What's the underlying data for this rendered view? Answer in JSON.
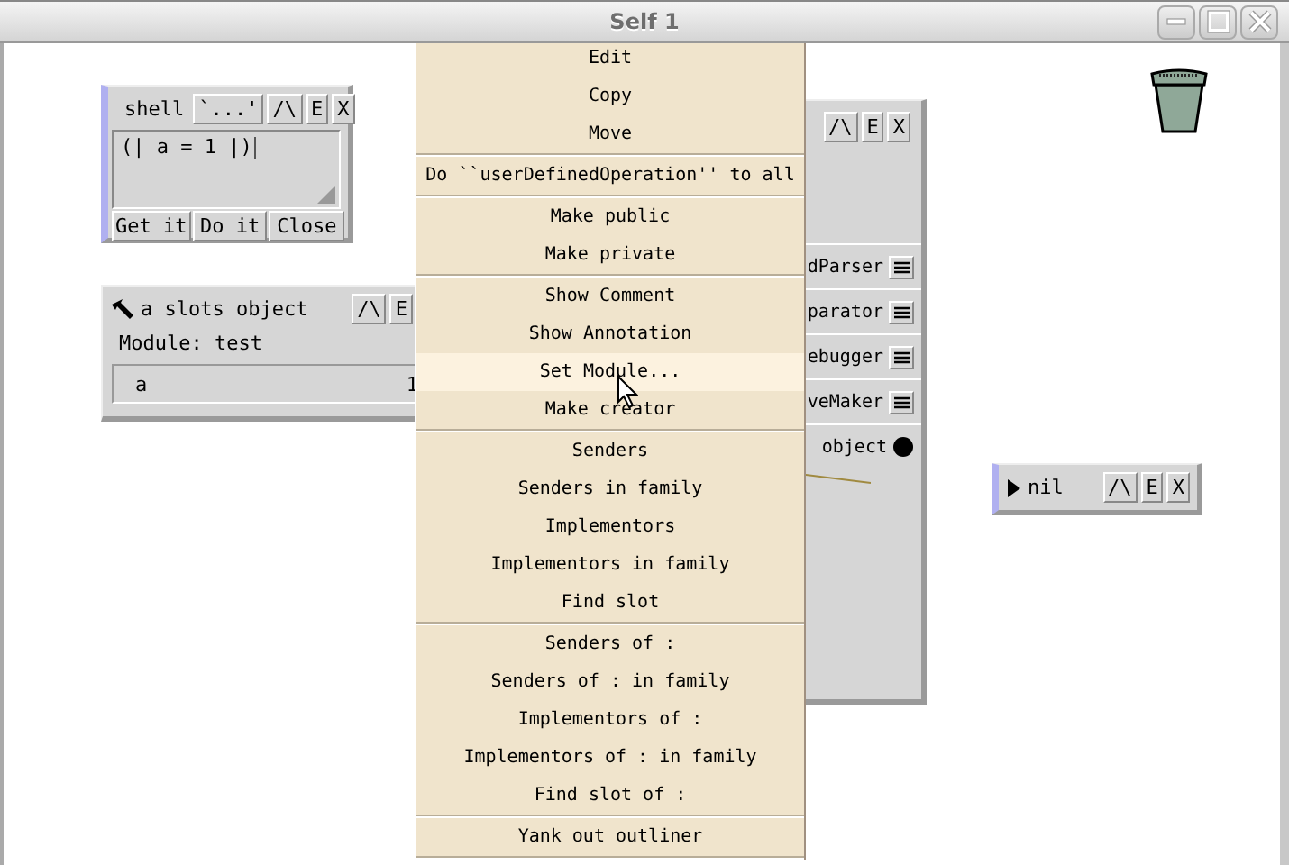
{
  "window": {
    "title": "Self 1"
  },
  "shell": {
    "title": "shell",
    "header_buttons": [
      "`...'",
      "/\\",
      "E",
      "X"
    ],
    "code": "(| a = 1 |)",
    "buttons": [
      "Get it",
      "Do it",
      "Close"
    ]
  },
  "slots_outliner": {
    "title": "a slots object",
    "header_buttons": [
      "/\\",
      "E"
    ],
    "module": "Module: test",
    "slots": [
      {
        "name": "a",
        "value": "1"
      }
    ]
  },
  "back_outliner": {
    "header_buttons": [
      "/\\",
      "E",
      "X"
    ],
    "slots": [
      {
        "text": "dParser",
        "kind": "button"
      },
      {
        "text": "parator",
        "kind": "button"
      },
      {
        "text": "ebugger",
        "kind": "button"
      },
      {
        "text": "veMaker",
        "kind": "button"
      },
      {
        "text": "object",
        "kind": "reference"
      }
    ]
  },
  "nil_outliner": {
    "title": "nil",
    "header_buttons": [
      "/\\",
      "E",
      "X"
    ]
  },
  "menu": {
    "groups": [
      [
        {
          "label": "Edit",
          "selected": false
        },
        {
          "label": "Copy",
          "selected": false
        },
        {
          "label": "Move",
          "selected": false
        }
      ],
      [
        {
          "label": "Do ``userDefinedOperation'' to all",
          "selected": false
        }
      ],
      [
        {
          "label": "Make public",
          "selected": false
        },
        {
          "label": "Make private",
          "selected": false
        }
      ],
      [
        {
          "label": "Show Comment",
          "selected": false
        },
        {
          "label": "Show Annotation",
          "selected": false
        },
        {
          "label": "Set Module...",
          "selected": true
        },
        {
          "label": "Make creator",
          "selected": false
        }
      ],
      [
        {
          "label": "Senders",
          "selected": false
        },
        {
          "label": "Senders in family",
          "selected": false
        },
        {
          "label": "Implementors",
          "selected": false
        },
        {
          "label": "Implementors in family",
          "selected": false
        },
        {
          "label": "Find slot",
          "selected": false
        }
      ],
      [
        {
          "label": "Senders of :",
          "selected": false
        },
        {
          "label": "Senders of : in family",
          "selected": false
        },
        {
          "label": "Implementors of :",
          "selected": false
        },
        {
          "label": "Implementors of : in family",
          "selected": false
        },
        {
          "label": "Find slot of :",
          "selected": false
        }
      ],
      [
        {
          "label": "Yank out outliner",
          "selected": false
        }
      ]
    ]
  }
}
